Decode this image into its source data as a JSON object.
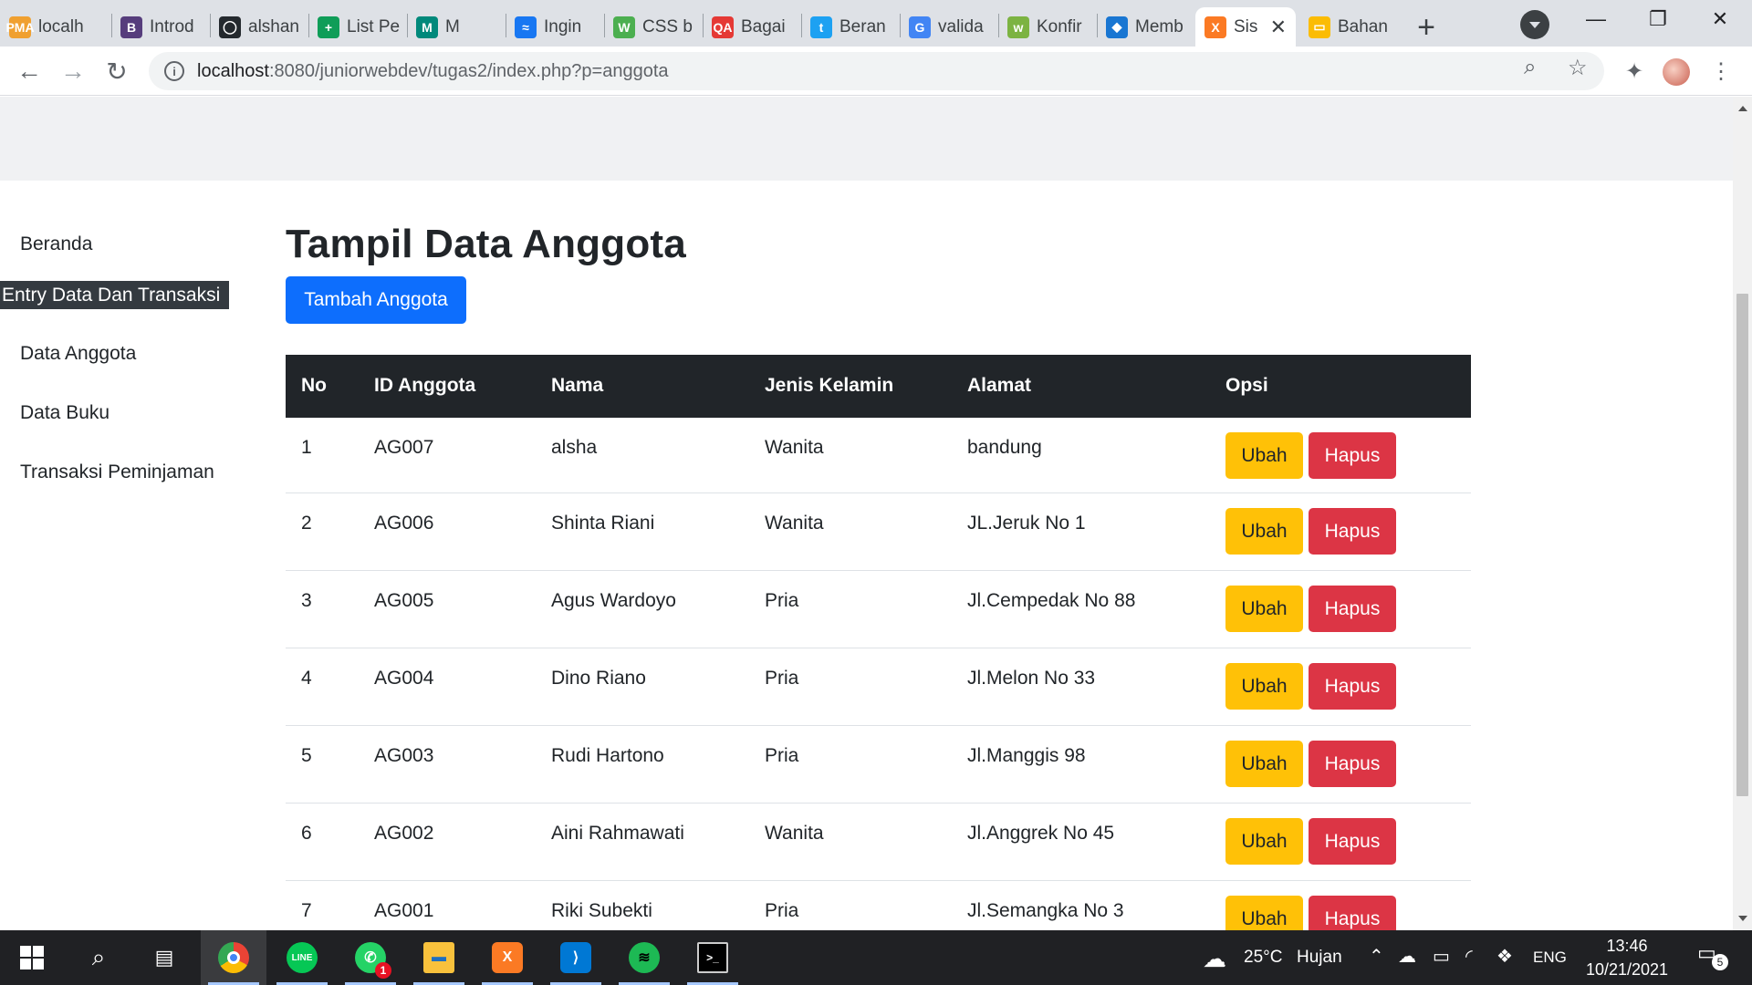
{
  "browser": {
    "tabs": [
      {
        "label": "localh",
        "fav_text": "PMA",
        "fav_color": "#f0a030"
      },
      {
        "label": "Introd",
        "fav_text": "B",
        "fav_color": "#563d7c"
      },
      {
        "label": "alshan",
        "fav_text": "◯",
        "fav_color": "#24292e"
      },
      {
        "label": "List Pe",
        "fav_text": "+",
        "fav_color": "#0f9d58"
      },
      {
        "label": "M",
        "fav_text": "M",
        "fav_color": "#00897b"
      },
      {
        "label": "Ingin",
        "fav_text": "≈",
        "fav_color": "#1877f2"
      },
      {
        "label": "CSS b",
        "fav_text": "W",
        "fav_color": "#4caf50"
      },
      {
        "label": "Bagai",
        "fav_text": "QA",
        "fav_color": "#e53935"
      },
      {
        "label": "Beran",
        "fav_text": "t",
        "fav_color": "#1da1f2"
      },
      {
        "label": "valida",
        "fav_text": "G",
        "fav_color": "#4285f4"
      },
      {
        "label": "Konfir",
        "fav_text": "w",
        "fav_color": "#7cb342"
      },
      {
        "label": "Memb",
        "fav_text": "◆",
        "fav_color": "#1976d2"
      },
      {
        "label": "Sis",
        "fav_text": "X",
        "fav_color": "#fb7a24"
      },
      {
        "label": "Bahan",
        "fav_text": "▭",
        "fav_color": "#fbbc04"
      }
    ],
    "active_tab_index": 12,
    "url_host": "localhost",
    "url_path": ":8080/junior​webdev/tugas2/index.php?p=anggota"
  },
  "sidebar": {
    "items": [
      {
        "label": "Beranda"
      },
      {
        "label": "Entry Data Dan Transaksi"
      },
      {
        "label": "Data Anggota"
      },
      {
        "label": "Data Buku"
      },
      {
        "label": "Transaksi Peminjaman"
      }
    ]
  },
  "main": {
    "title": "Tampil Data Anggota",
    "add_button": "Tambah Anggota",
    "table": {
      "columns": [
        "No",
        "ID Anggota",
        "Nama",
        "Jenis Kelamin",
        "Alamat",
        "Opsi"
      ],
      "rows": [
        {
          "no": "1",
          "id": "AG007",
          "nama": "alsha",
          "jk": "Wanita",
          "alamat": "bandung"
        },
        {
          "no": "2",
          "id": "AG006",
          "nama": "Shinta Riani",
          "jk": "Wanita",
          "alamat": "JL.Jeruk No 1"
        },
        {
          "no": "3",
          "id": "AG005",
          "nama": "Agus Wardoyo",
          "jk": "Pria",
          "alamat": "Jl.Cempedak No 88"
        },
        {
          "no": "4",
          "id": "AG004",
          "nama": "Dino Riano",
          "jk": "Pria",
          "alamat": "Jl.Melon No 33"
        },
        {
          "no": "5",
          "id": "AG003",
          "nama": "Rudi Hartono",
          "jk": "Pria",
          "alamat": "Jl.Manggis 98"
        },
        {
          "no": "6",
          "id": "AG002",
          "nama": "Aini Rahmawati",
          "jk": "Wanita",
          "alamat": "Jl.Anggrek No 45"
        },
        {
          "no": "7",
          "id": "AG001",
          "nama": "Riki Subekti",
          "jk": "Pria",
          "alamat": "Jl.Semangka No 3"
        }
      ],
      "edit_label": "Ubah",
      "delete_label": "Hapus"
    }
  },
  "taskbar": {
    "weather_temp": "25°C",
    "weather_desc": "Hujan",
    "language": "ENG",
    "time": "13:46",
    "date": "10/21/2021",
    "notification_count": "5",
    "whatsapp_badge": "1"
  },
  "colors": {
    "primary": "#0d6efd",
    "warning": "#ffc107",
    "danger": "#dc3545",
    "table_head": "#212529"
  }
}
